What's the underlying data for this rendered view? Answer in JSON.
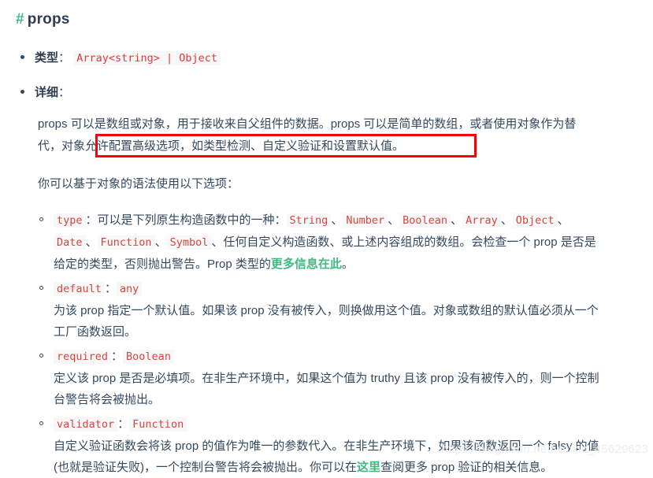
{
  "heading": {
    "anchor": "#",
    "text": "props"
  },
  "colors": {
    "accent_green": "#42b983",
    "code_red": "#e4393c",
    "heading": "#2c3e50",
    "body_text": "#34495e",
    "annotation_box": "#fb0007",
    "code_background": "#f8f8f8",
    "watermark": "#eceef0"
  },
  "sections": {
    "type_item": {
      "label": "类型",
      "colon": "：",
      "code": "Array<string> | Object"
    },
    "detail_item": {
      "label": "详细",
      "colon": "："
    }
  },
  "detail": {
    "paragraph1_part1": "props 可以是数组或对象，用于接收来自父组件的数据。props 可以是简单的数组，或者使用对象作为替代，",
    "paragraph1_highlighted": "对象允许配置高级选项，如类型检测、自定义验证和设置默认值。",
    "paragraph2": "你可以基于对象的语法使用以下选项："
  },
  "options": [
    {
      "name": "type",
      "colon": "：",
      "value": "",
      "desc_before": "可以是下列原生构造函数中的一种：",
      "types": [
        "String",
        "Number",
        "Boolean",
        "Array",
        "Object",
        "Date",
        "Function",
        "Symbol"
      ],
      "separator": "、",
      "desc_after": "任何自定义构造函数、或上述内容组成的数组。会检查一个 prop 是否是给定的类型，否则抛出警告。Prop 类型的",
      "link_text": "更多信息在此",
      "desc_tail": "。"
    },
    {
      "name": "default",
      "colon": "：",
      "value": "any",
      "desc": "为该 prop 指定一个默认值。如果该 prop 没有被传入，则换做用这个值。对象或数组的默认值必须从一个工厂函数返回。"
    },
    {
      "name": "required",
      "colon": "：",
      "value": "Boolean",
      "desc": "定义该 prop 是否是必填项。在非生产环境中，如果这个值为 truthy 且该 prop 没有被传入的，则一个控制台警告将会被抛出。"
    },
    {
      "name": "validator",
      "colon": "：",
      "value": "Function",
      "desc_before": "自定义验证函数会将该 prop 的值作为唯一的参数代入。在非生产环境下，如果该函数返回一个 falsy 的值 (也就是验证失败)，一个控制台警告将会被抛出。你可以在",
      "link_text": "这里",
      "desc_after": "查阅更多 prop 验证的相关信息。"
    }
  ],
  "watermark": "https://blog.csdn.net/weixin_45629623"
}
